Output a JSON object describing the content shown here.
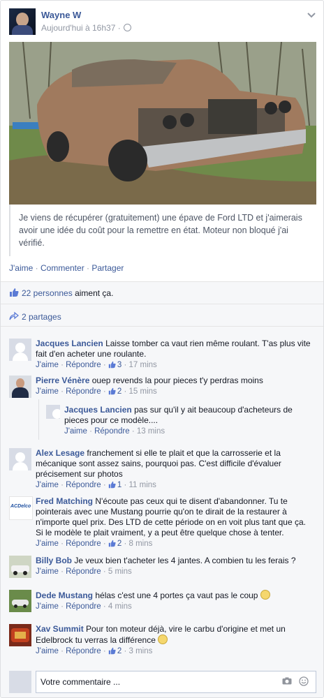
{
  "post": {
    "author": "Wayne W",
    "time": "Aujourd'hui à 16h37 ·",
    "text": "Je viens de récupérer (gratuitement) une épave de Ford LTD et j'aimerais avoir une idée du coût pour la remettre en état. Moteur non bloqué j'ai vérifié.",
    "actions": {
      "like": "J'aime",
      "comment": "Commenter",
      "share": "Partager",
      "sep": "·"
    }
  },
  "likes": {
    "people_link": "22 personnes",
    "suffix": " aiment ça."
  },
  "shares": {
    "label": "2 partages"
  },
  "comments": [
    {
      "name": "Jacques Lancien",
      "text": "Laisse tomber ca vaut rien même roulant. T'as plus vite fait d'en acheter une roulante.",
      "like": "J'aime",
      "reply": "Répondre",
      "likes": "3",
      "time": "17 mins"
    },
    {
      "name": "Pierre Vénère",
      "text": "ouep revends la pour pieces t'y perdras moins",
      "like": "J'aime",
      "reply": "Répondre",
      "likes": "2",
      "time": "15 mins"
    },
    {
      "name": "Alex Lesage",
      "text": "franchement si elle te plait et que la carrosserie et la mécanique sont assez sains, pourquoi pas. C'est difficile d'évaluer précisement sur photos",
      "like": "J'aime",
      "reply": "Répondre",
      "likes": "1",
      "time": "11 mins"
    },
    {
      "name": "Fred Matching",
      "text": "N'écoute pas ceux qui te disent d'abandonner. Tu te pointerais avec une Mustang pourrie qu'on te dirait de la restaurer à n'importe quel prix. Des LTD de cette période on en voit plus tant que ça. Si le modèle te plait vraiment, y a peut être quelque chose à tenter.",
      "like": "J'aime",
      "reply": "Répondre",
      "likes": "2",
      "time": "8 mins"
    },
    {
      "name": "Billy Bob",
      "text": "Je veux bien t'acheter les 4 jantes. A combien tu les ferais ?",
      "like": "J'aime",
      "reply": "Répondre",
      "time": "5 mins"
    },
    {
      "name": "Dede Mustang",
      "text": "hélas c'est une 4 portes ça vaut pas le coup",
      "like": "J'aime",
      "reply": "Répondre",
      "time": "4 mins"
    },
    {
      "name": "Xav Summit",
      "text": "Pour ton moteur déjà, vire le carbu d'origine et met un Edelbrock tu verras la différence",
      "like": "J'aime",
      "reply": "Répondre",
      "likes": "2",
      "time": "3 mins"
    }
  ],
  "reply": {
    "name": "Jacques Lancien",
    "text": "pas sur qu'il y ait beaucoup d'acheteurs de pieces pour ce modèle....",
    "like": "J'aime",
    "reply": "Répondre",
    "time": "13 mins"
  },
  "composer": {
    "placeholder": "Votre commentaire ..."
  },
  "icons": {
    "logo_text": "ACDelco"
  },
  "colors": {
    "link": "#3b5998",
    "meta": "#9197a3",
    "background": "#f6f7f9"
  }
}
